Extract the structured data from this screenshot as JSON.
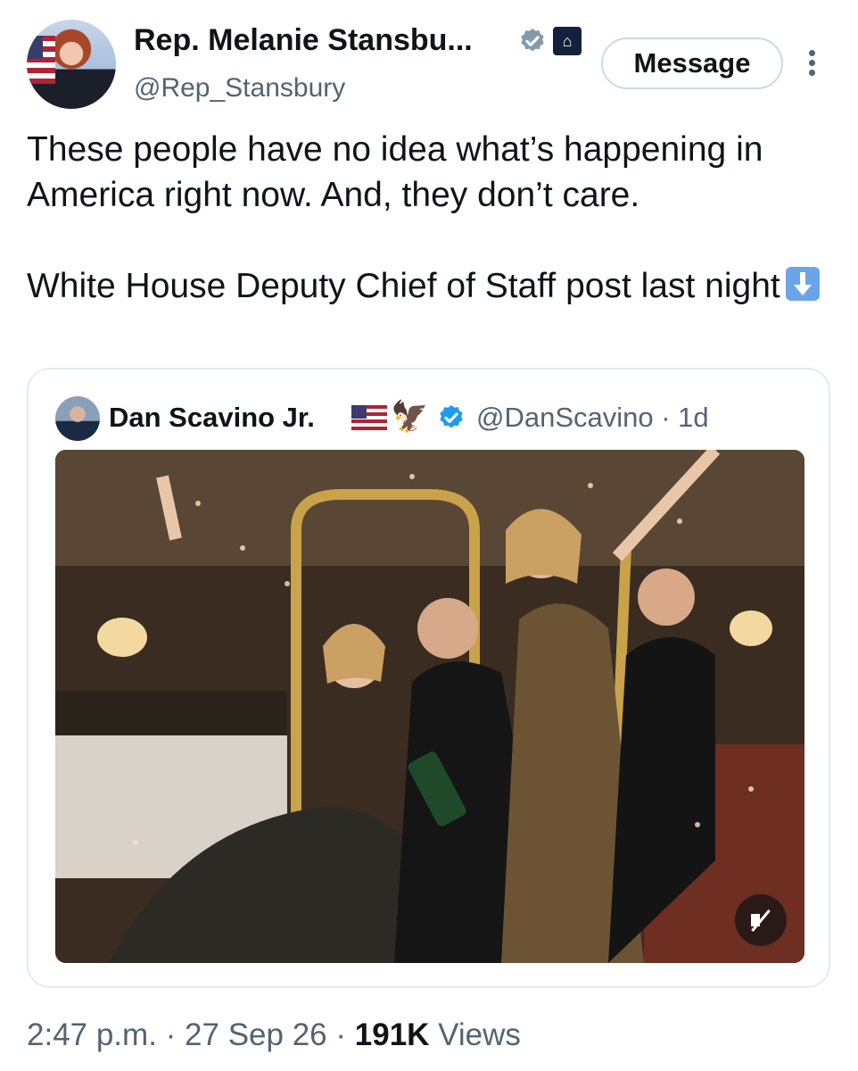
{
  "author": {
    "display_name": "Rep. Melanie Stansbu...",
    "handle": "@Rep_Stansbury",
    "avatar": "profile-photo",
    "badges": [
      "verified-badge-icon",
      "government-capitol-icon"
    ]
  },
  "actions": {
    "message_label": "Message",
    "more_icon": "more-options-icon"
  },
  "tweet": {
    "line1": "These people have no idea what’s happening in America right now. And, they don’t care.",
    "line2": "White House Deputy Chief of Staff post last night",
    "emoji_icon": "down-arrow-emoji-icon"
  },
  "quoted": {
    "display_name": "Dan Scavino Jr.",
    "handle_time": "@DanScavino · 1d",
    "media_icon": "video-muted-icon"
  },
  "meta": {
    "time": "2:47 p.m.",
    "date": "27 Sep 26",
    "views_count": "191K",
    "views_label": "Views"
  },
  "colors": {
    "text": "#0f1419",
    "secondary": "#536471",
    "verified": "#1d9bf0",
    "border": "#cfd9de"
  }
}
